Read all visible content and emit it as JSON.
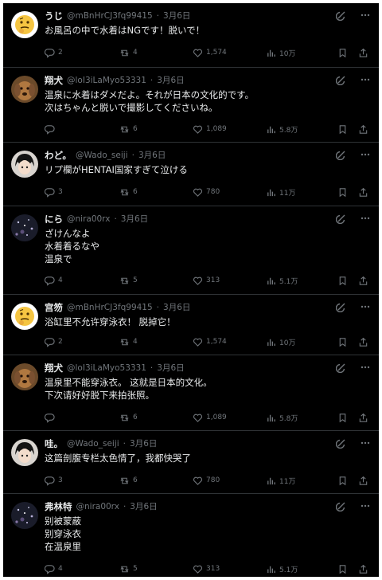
{
  "tweets": [
    {
      "name": "うじ",
      "handle": "@mBnHrCJ3fq99415",
      "date": "3月6日",
      "lines": [
        "お風呂の中で水着はNGです！脱いで！"
      ],
      "stats": {
        "replies": "2",
        "reposts": "4",
        "likes": "1,574",
        "views": "10万"
      },
      "avatar": "thinking-emoji"
    },
    {
      "name": "翔犬",
      "handle": "@loI3iLaMyo53331",
      "date": "3月6日",
      "lines": [
        "温泉に水着はダメだよ。それが日本の文化的です。",
        "次はちゃんと脱いで撮影してくださいね。"
      ],
      "stats": {
        "replies": "",
        "reposts": "6",
        "likes": "1,089",
        "views": "5.8万"
      },
      "avatar": "dog-photo"
    },
    {
      "name": "わど。",
      "handle": "@Wado_seiji",
      "date": "3月6日",
      "lines": [
        "リプ欄がHENTAI国家すぎて泣ける"
      ],
      "stats": {
        "replies": "3",
        "reposts": "6",
        "likes": "780",
        "views": "11万"
      },
      "avatar": "anime-boy"
    },
    {
      "name": "にら",
      "handle": "@nira00rx",
      "date": "3月6日",
      "lines": [
        "ざけんなよ",
        "水着着るなや",
        "温泉で"
      ],
      "stats": {
        "replies": "4",
        "reposts": "5",
        "likes": "313",
        "views": "5.1万"
      },
      "avatar": "starry-dark"
    },
    {
      "name": "宫笏",
      "handle": "@mBnHrCJ3fq99415",
      "date": "3月6日",
      "lines": [
        "浴缸里不允许穿泳衣！ 脱掉它！"
      ],
      "stats": {
        "replies": "2",
        "reposts": "4",
        "likes": "1,574",
        "views": "10万"
      },
      "avatar": "thinking-emoji"
    },
    {
      "name": "翔犬",
      "handle": "@loI3iLaMyo53331",
      "date": "3月6日",
      "lines": [
        "温泉里不能穿泳衣。 这就是日本的文化。",
        "下次请好好脱下来拍张照。"
      ],
      "stats": {
        "replies": "",
        "reposts": "6",
        "likes": "1,089",
        "views": "5.8万"
      },
      "avatar": "dog-photo"
    },
    {
      "name": "哇。",
      "handle": "@Wado_seiji",
      "date": "3月6日",
      "lines": [
        "这篇剖腹专栏太色情了，我都快哭了"
      ],
      "stats": {
        "replies": "3",
        "reposts": "6",
        "likes": "780",
        "views": "11万"
      },
      "avatar": "anime-boy"
    },
    {
      "name": "弗林特",
      "handle": "@nira00rx",
      "date": "3月6日",
      "lines": [
        "别被蒙蔽",
        "别穿泳衣",
        "在温泉里"
      ],
      "stats": {
        "replies": "4",
        "reposts": "5",
        "likes": "313",
        "views": "5.1万"
      },
      "avatar": "starry-dark"
    }
  ],
  "colors": {
    "background": "#000000",
    "text": "#e7e9ea",
    "muted": "#71767b",
    "border": "#2f3336"
  },
  "icons": [
    "reply-icon",
    "repost-icon",
    "like-icon",
    "views-icon",
    "bookmark-icon",
    "share-icon",
    "grok-icon",
    "more-icon"
  ]
}
